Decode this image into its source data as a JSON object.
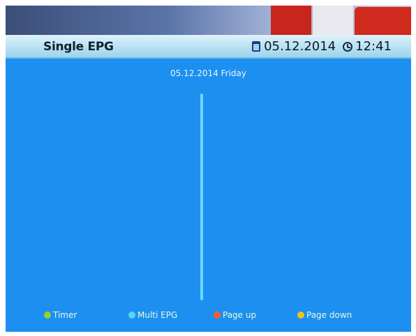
{
  "header": {
    "title": "Single EPG",
    "date": "05.12.2014",
    "time": "12:41"
  },
  "epg": {
    "current_date": "05.12.2014  Friday"
  },
  "footer": {
    "keys": [
      {
        "label": "Timer",
        "color": "#8fd62a"
      },
      {
        "label": "Multi EPG",
        "color": "#55d6f2"
      },
      {
        "label": "Page up",
        "color": "#ff5a2a"
      },
      {
        "label": "Page down",
        "color": "#f2c21a"
      }
    ]
  },
  "colors": {
    "background": "#1d8ff0",
    "header_bar": "#b7e1f3",
    "divider": "#6fd9ff"
  },
  "icons": {
    "calendar": "calendar-icon",
    "clock": "clock-icon"
  }
}
